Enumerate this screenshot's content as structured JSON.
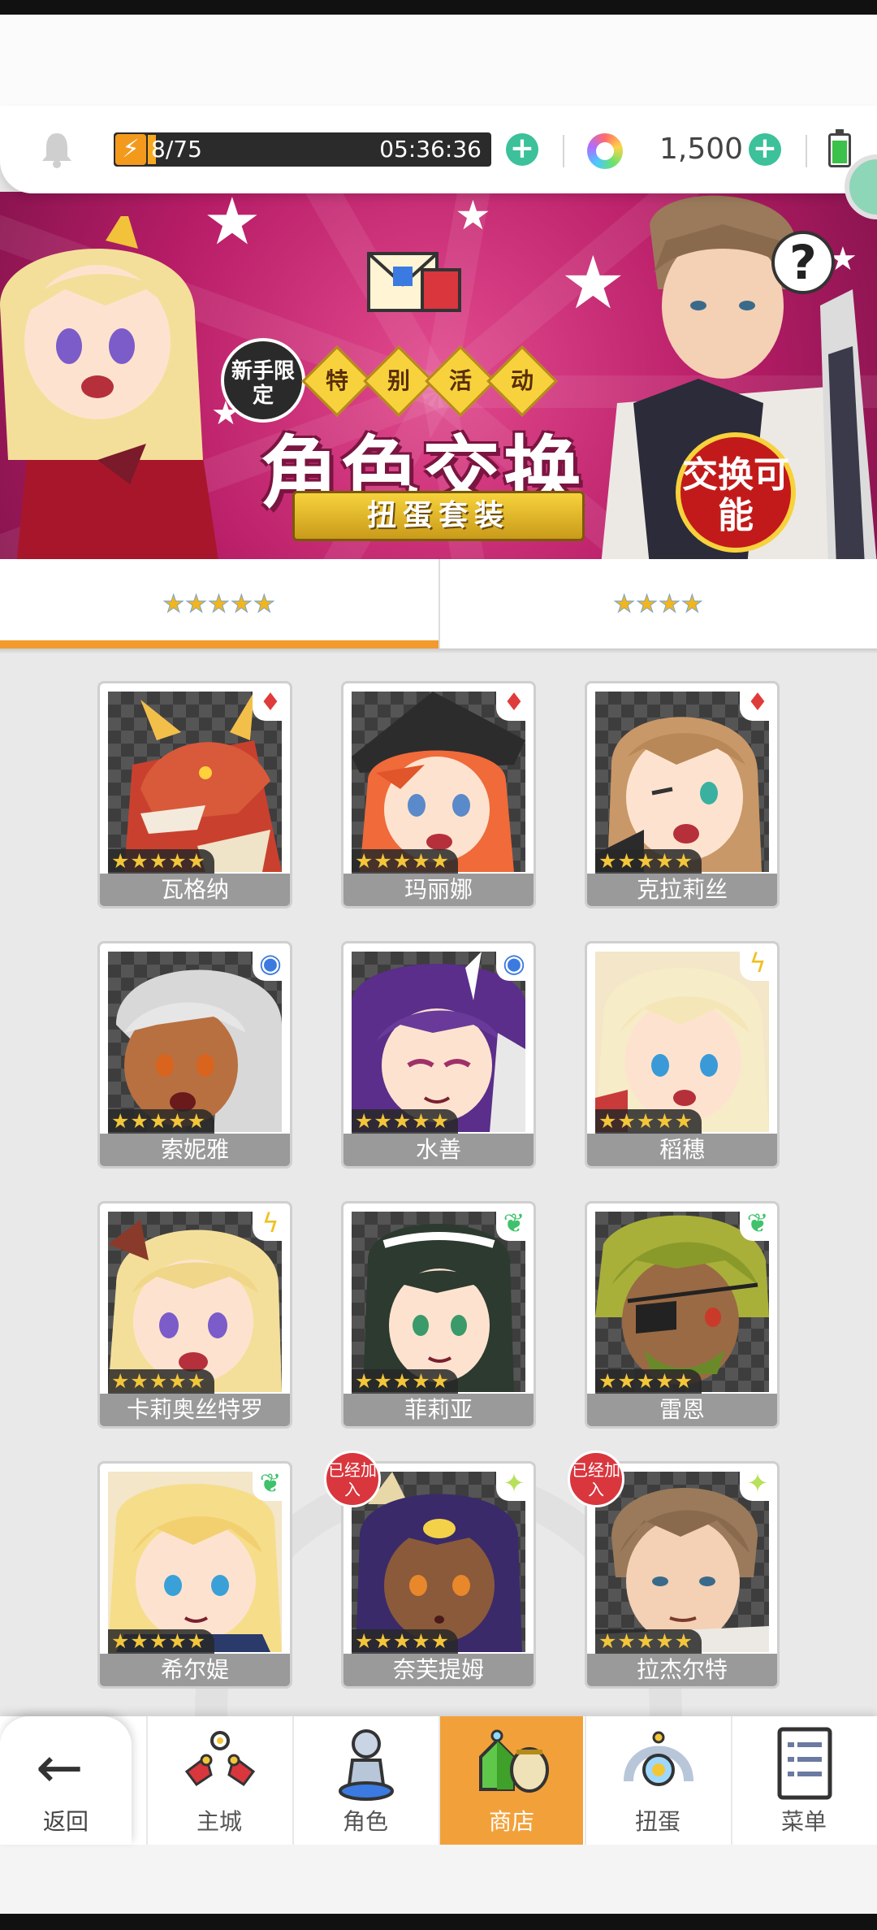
{
  "resources": {
    "stamina_value": "8/75",
    "stamina_timer": "05:36:36",
    "gem_count": "1,500"
  },
  "banner": {
    "new_badge": "新手限定",
    "event_tags": [
      "特",
      "别",
      "活",
      "动"
    ],
    "title": "角色交换",
    "subtitle": "扭蛋套装",
    "exchange_badge": "交换可能",
    "help": "?"
  },
  "tabs": [
    {
      "label": "★★★★★",
      "active": true
    },
    {
      "label": "★★★★",
      "active": false
    }
  ],
  "characters": [
    {
      "name": "瓦格纳",
      "stars": "★★★★★",
      "element": "fire-icon"
    },
    {
      "name": "玛丽娜",
      "stars": "★★★★★",
      "element": "fire-icon"
    },
    {
      "name": "克拉莉丝",
      "stars": "★★★★★",
      "element": "fire-icon"
    },
    {
      "name": "索妮雅",
      "stars": "★★★★★",
      "element": "water-icon"
    },
    {
      "name": "水善",
      "stars": "★★★★★",
      "element": "water-icon"
    },
    {
      "name": "稻穗",
      "stars": "★★★★★",
      "element": "thunder-icon"
    },
    {
      "name": "卡莉奥丝特罗",
      "stars": "★★★★★",
      "element": "thunder-icon"
    },
    {
      "name": "菲莉亚",
      "stars": "★★★★★",
      "element": "wind-icon"
    },
    {
      "name": "雷恩",
      "stars": "★★★★★",
      "element": "wind-icon"
    },
    {
      "name": "希尔媞",
      "stars": "★★★★★",
      "element": "wind-icon"
    },
    {
      "name": "奈芙提姆",
      "stars": "★★★★★",
      "element": "light-icon",
      "added_badge": "已经加入"
    },
    {
      "name": "拉杰尔特",
      "stars": "★★★★★",
      "element": "light-icon",
      "added_badge": "已经加入"
    }
  ],
  "nav": {
    "back": "返回",
    "items": [
      {
        "label": "主城",
        "active": false
      },
      {
        "label": "角色",
        "active": false
      },
      {
        "label": "商店",
        "active": true
      },
      {
        "label": "扭蛋",
        "active": false
      },
      {
        "label": "菜单",
        "active": false
      }
    ]
  },
  "colors": {
    "accent": "#f29a2e",
    "banner": "#c42a78",
    "plus": "#3cc19a",
    "added_badge": "#d9363e"
  }
}
